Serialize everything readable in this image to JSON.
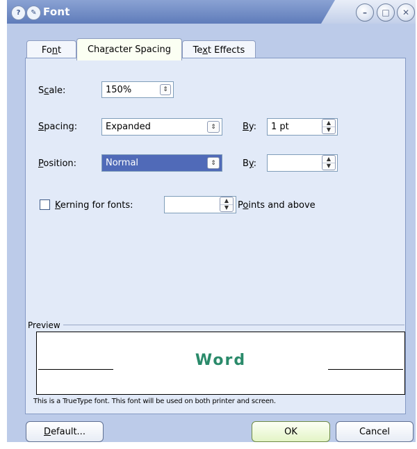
{
  "window": {
    "title": "Font"
  },
  "tabs": [
    {
      "label": "Font",
      "mnemonic": "n"
    },
    {
      "label": "Character Spacing",
      "mnemonic": "r"
    },
    {
      "label": "Text Effects",
      "mnemonic": "x"
    }
  ],
  "fields": {
    "scale": {
      "label": "Scale:",
      "value": "150%"
    },
    "spacing": {
      "label": "Spacing:",
      "value": "Expanded",
      "by_label": "By:",
      "by_value": "1 pt"
    },
    "position": {
      "label": "Position:",
      "value": "Normal",
      "by_label": "By:",
      "by_value": ""
    },
    "kerning": {
      "label": "Kerning for fonts:",
      "checked": false,
      "value": "",
      "suffix": "Points and above"
    }
  },
  "preview": {
    "label": "Preview",
    "sample_text": "Word",
    "sample_color": "#2a8a6a",
    "note": "This is a TrueType font. This font will be used on both printer and screen."
  },
  "buttons": {
    "default": "Default...",
    "ok": "OK",
    "cancel": "Cancel"
  }
}
